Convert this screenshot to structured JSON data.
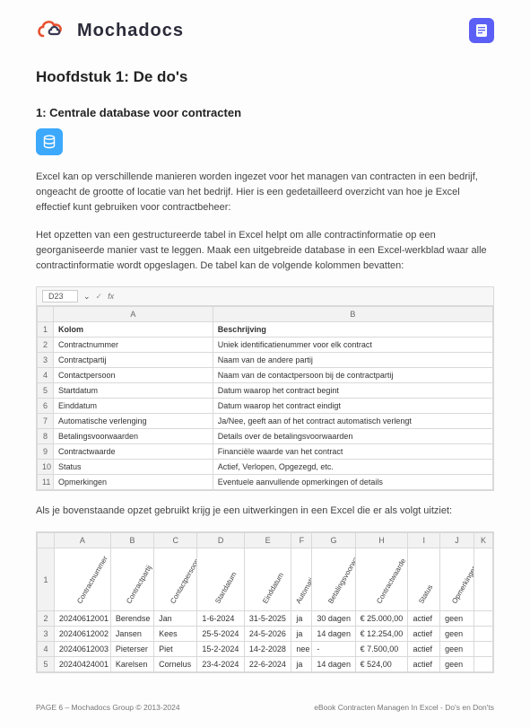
{
  "header": {
    "brand": "Mochadocs"
  },
  "chapter_title": "Hoofdstuk 1: De do's",
  "section_title": "1: Centrale database voor contracten",
  "para1": "Excel kan op verschillende manieren worden ingezet voor het managen van contracten in een bedrijf, ongeacht de grootte of locatie van het bedrijf. Hier is een gedetailleerd overzicht van hoe je Excel effectief kunt gebruiken voor contractbeheer:",
  "para2": "Het opzetten van een gestructureerde tabel in Excel helpt om alle contractinformatie op een georganiseerde manier vast te leggen. Maak een uitgebreide database in een Excel-werkblad waar alle contractinformatie wordt opgeslagen. De tabel kan de volgende kolommen bevatten:",
  "para3": "Als je bovenstaande opzet gebruikt krijg je een uitwerkingen in een Excel die er als volgt uitziet:",
  "excel1": {
    "cell_ref": "D23",
    "col_a": "A",
    "col_b": "B",
    "header_a": "Kolom",
    "header_b": "Beschrijving",
    "rows": [
      {
        "n": "2",
        "a": "Contractnummer",
        "b": "Uniek identificatienummer voor elk contract"
      },
      {
        "n": "3",
        "a": "Contractpartij",
        "b": "Naam van de andere partij"
      },
      {
        "n": "4",
        "a": "Contactpersoon",
        "b": "Naam van de contactpersoon bij de contractpartij"
      },
      {
        "n": "5",
        "a": "Startdatum",
        "b": "Datum waarop het contract begint"
      },
      {
        "n": "6",
        "a": "Einddatum",
        "b": "Datum waarop het contract eindigt"
      },
      {
        "n": "7",
        "a": "Automatische verlenging",
        "b": "Ja/Nee, geeft aan of het contract automatisch verlengt"
      },
      {
        "n": "8",
        "a": "Betalingsvoorwaarden",
        "b": "Details over de betalingsvoorwaarden"
      },
      {
        "n": "9",
        "a": "Contractwaarde",
        "b": "Financiële waarde van het contract"
      },
      {
        "n": "10",
        "a": "Status",
        "b": "Actief, Verlopen, Opgezegd, etc."
      },
      {
        "n": "11",
        "a": "Opmerkingen",
        "b": "Eventuele aanvullende opmerkingen of details"
      }
    ]
  },
  "excel2": {
    "cols": [
      "A",
      "B",
      "C",
      "D",
      "E",
      "F",
      "G",
      "H",
      "I",
      "J",
      "K"
    ],
    "headers": [
      "Contractnummer",
      "Contractpartij",
      "Contactpersoon",
      "Startdatum",
      "Einddatum",
      "Automatische verlenging",
      "Betalingsvoorwaarden",
      "Contractwaarde",
      "Status",
      "Opmerkingen"
    ],
    "rows": [
      {
        "n": "2",
        "v": [
          "20240612001",
          "Berendse",
          "Jan",
          "1-6-2024",
          "31-5-2025",
          "ja",
          "30 dagen",
          "€  25.000,00",
          "actief",
          "geen"
        ]
      },
      {
        "n": "3",
        "v": [
          "20240612002",
          "Jansen",
          "Kees",
          "25-5-2024",
          "24-5-2026",
          "ja",
          "14 dagen",
          "€  12.254,00",
          "actief",
          "geen"
        ]
      },
      {
        "n": "4",
        "v": [
          "20240612003",
          "Pieterser",
          "Piet",
          "15-2-2024",
          "14-2-2028",
          "nee",
          "-",
          "€   7.500,00",
          "actief",
          "geen"
        ]
      },
      {
        "n": "5",
        "v": [
          "20240424001",
          "Karelsen",
          "Cornelus",
          "23-4-2024",
          "22-6-2024",
          "ja",
          "14 dagen",
          "€     524,00",
          "actief",
          "geen"
        ]
      }
    ]
  },
  "footer": {
    "left": "PAGE 6 – Mochadocs Group © 2013-2024",
    "right": "eBook Contracten Managen In Excel - Do's en Don'ts"
  }
}
